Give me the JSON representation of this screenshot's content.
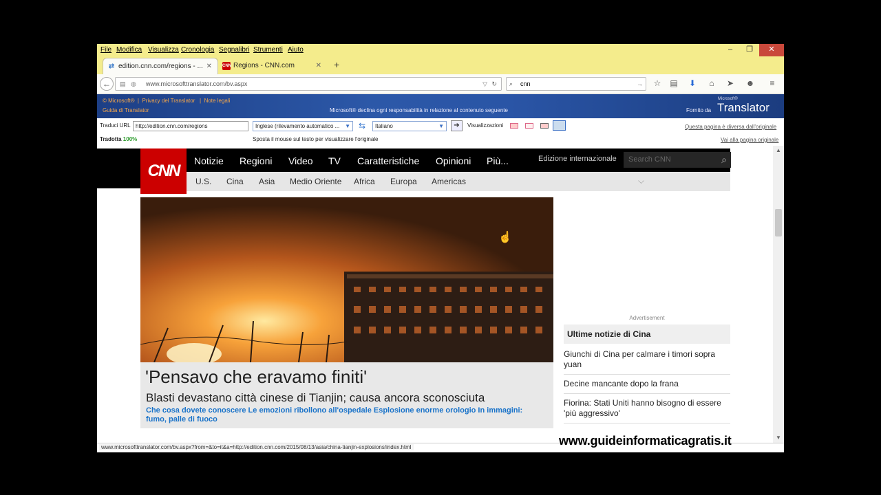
{
  "menu": [
    "File",
    "Modifica",
    "Visualizza",
    "Cronologia",
    "Segnalibri",
    "Strumenti",
    "Aiuto"
  ],
  "tabs": [
    {
      "label": "edition.cnn.com/regions - ...",
      "icon": "translator-icon"
    },
    {
      "label": "Regions - CNN.com",
      "icon": "cnn-icon"
    }
  ],
  "nav": {
    "url": "www.microsofttranslator.com/bv.aspx",
    "search": "cnn"
  },
  "translator": {
    "links": [
      "© Microsoft®",
      "Privacy del Translator",
      "Note legali"
    ],
    "guide": "Guida di Translator",
    "disclaimer": "Microsoft® declina ogni responsabilità in relazione al contenuto seguente",
    "provided": "Fornito da",
    "brand_small": "Microsoft®",
    "brand": "Translator",
    "url_label": "Traduci URL",
    "url_value": "http://edition.cnn.com/regions",
    "from_lang": "Inglese (rilevamento automatico ...",
    "to_lang": "Italiano",
    "views_label": "Visualizzazioni",
    "diff_link": "Questa pagina è diversa dall'originale",
    "translated_label": "Tradotta",
    "translated_pct": "100%",
    "hover_hint": "Sposta il mouse sul testo per visualizzare l'originale",
    "orig_link": "Vai alla pagina originale"
  },
  "cnn": {
    "logo": "CNN",
    "nav": [
      "Notizie",
      "Regioni",
      "Video",
      "TV",
      "Caratteristiche",
      "Opinioni",
      "Più..."
    ],
    "edition": "Edizione internazionale",
    "search_placeholder": "Search CNN",
    "sub": [
      "U.S.",
      "Cina",
      "Asia",
      "Medio Oriente",
      "Africa",
      "Europa",
      "Americas"
    ],
    "headline": "'Pensavo che eravamo finiti'",
    "subhead": "Blasti devastano città cinese di Tianjin; causa ancora sconosciuta",
    "links": "Che cosa dovete conoscere Le emozioni ribollono all'ospedale Esplosione enorme orologio In immagini: fumo, palle di fuoco",
    "advert": "Advertisement",
    "side_title": "Ultime notizie di Cina",
    "side_items": [
      "Giunchi di Cina per calmare i timori sopra yuan",
      "Decine mancante dopo la frana",
      "Fiorina: Stati Uniti hanno bisogno di essere 'più aggressivo'"
    ]
  },
  "status": "www.microsofttranslator.com/bv.aspx?from=&to=it&a=http://edition.cnn.com/2015/08/13/asia/china-tianjin-explosions/index.html",
  "watermark": "www.guideinformaticagratis.it"
}
